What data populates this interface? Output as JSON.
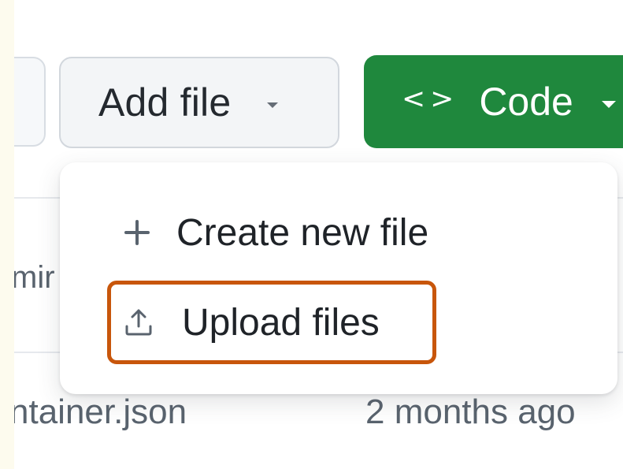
{
  "toolbar": {
    "add_file_label": "Add file",
    "code_label": "Code",
    "code_glyph": "<>"
  },
  "dropdown": {
    "items": [
      {
        "label": "Create new file",
        "icon": "plus-icon"
      },
      {
        "label": "Upload files",
        "icon": "upload-icon"
      }
    ]
  },
  "background": {
    "partial_text": "mir",
    "file_name": "ntainer.json",
    "file_time": "2 months ago"
  },
  "colors": {
    "code_button": "#1f883d",
    "highlight_border": "#c8560b"
  }
}
